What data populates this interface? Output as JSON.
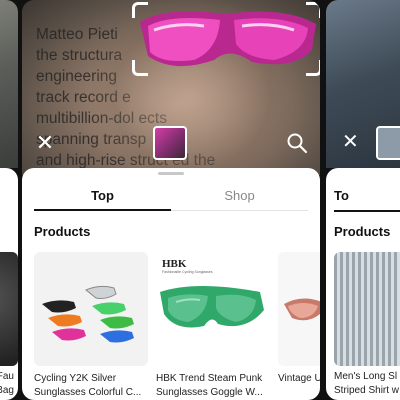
{
  "camera": {
    "article_lines": [
      "Matteo Pieti",
      "the structura",
      "engineering",
      "track record e",
      "multibillion-dol          ects",
      "spanning transp",
      "and high-rise struct          ed the"
    ]
  },
  "tabs": {
    "top_label": "Top",
    "shop_label": "Shop"
  },
  "section_title": "Products",
  "products": [
    {
      "name_line1": "Cycling Y2K Silver",
      "name_line2": "Sunglasses Colorful C..."
    },
    {
      "brand": "HBK",
      "brand_sub": "Fashionable Cycling Sunglasses",
      "name_line1": "HBK Trend Steam Punk",
      "name_line2": "Sunglasses Goggle W..."
    },
    {
      "name_line1": "Vintage U"
    }
  ],
  "right_panel": {
    "tab_label": "To",
    "section_title": "Products",
    "product_line1": "Men's Long Sl",
    "product_line2": "Striped Shirt w"
  },
  "left_panel": {
    "product_line1": "irt Fau",
    "product_line2": "n Bag"
  },
  "icons": [
    "close-icon",
    "search-icon",
    "crop-frame-icon"
  ],
  "colors": {
    "accent": "#111111",
    "muted_tab": "#888888"
  }
}
